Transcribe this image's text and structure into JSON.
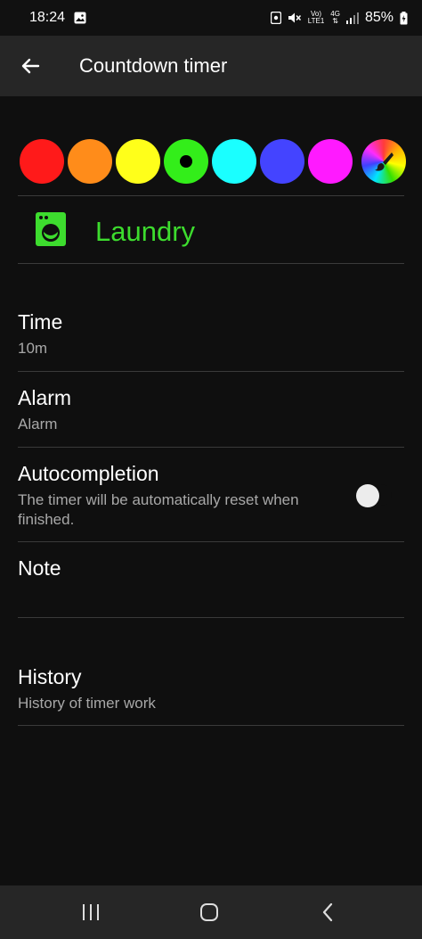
{
  "status_bar": {
    "time": "18:24",
    "volte_label": "Vo)\nLTE1",
    "network_type": "4G",
    "battery_percent": "85%"
  },
  "app_bar": {
    "title": "Countdown timer"
  },
  "colors": [
    {
      "name": "red",
      "hex": "#ff1a1a",
      "selected": false
    },
    {
      "name": "orange",
      "hex": "#ff8c1a",
      "selected": false
    },
    {
      "name": "yellow",
      "hex": "#ffff1a",
      "selected": false
    },
    {
      "name": "green",
      "hex": "#33ee1a",
      "selected": true
    },
    {
      "name": "cyan",
      "hex": "#1affff",
      "selected": false
    },
    {
      "name": "blue",
      "hex": "#4444ff",
      "selected": false
    },
    {
      "name": "magenta",
      "hex": "#ff1aff",
      "selected": false
    },
    {
      "name": "custom",
      "hex": "",
      "selected": false
    }
  ],
  "timer": {
    "name": "Laundry",
    "icon": "washing-machine-icon",
    "accent": "#3ddc2e"
  },
  "settings": {
    "time": {
      "title": "Time",
      "value": "10m"
    },
    "alarm": {
      "title": "Alarm",
      "value": "Alarm"
    },
    "autocompletion": {
      "title": "Autocompletion",
      "description": "The timer will be automatically reset when finished.",
      "enabled": false
    },
    "note": {
      "title": "Note",
      "value": ""
    },
    "history": {
      "title": "History",
      "description": "History of timer work"
    }
  },
  "nav_bar": {
    "recents_icon": "recents-icon",
    "home_icon": "home-icon",
    "back_icon": "back-icon"
  }
}
